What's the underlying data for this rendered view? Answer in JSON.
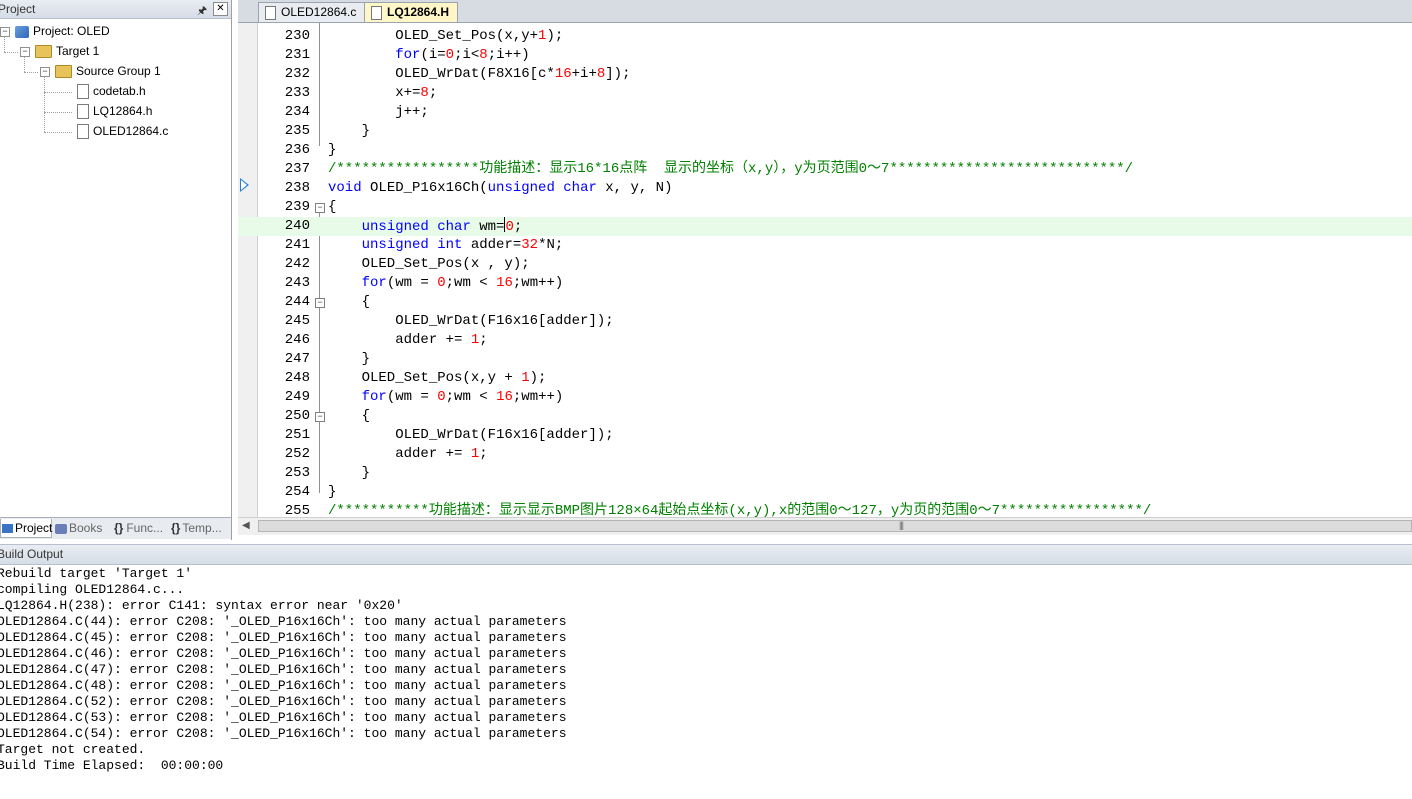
{
  "project_panel": {
    "title": "Project",
    "pin_icon": "pin-icon",
    "close_icon": "close-icon",
    "tree": [
      {
        "label": "Project: OLED",
        "icon": "project-icon"
      },
      {
        "label": "Target 1",
        "icon": "folder-icon"
      },
      {
        "label": "Source Group 1",
        "icon": "folder-icon"
      },
      {
        "label": "codetab.h",
        "icon": "file-icon"
      },
      {
        "label": "LQ12864.h",
        "icon": "file-icon"
      },
      {
        "label": "OLED12864.c",
        "icon": "file-icon"
      }
    ],
    "tabs": [
      {
        "label": "Project",
        "icon": "project-icon"
      },
      {
        "label": "Books",
        "icon": "books-icon"
      },
      {
        "label": "Func...",
        "icon": "functions-icon"
      },
      {
        "label": "Temp...",
        "icon": "templates-icon"
      }
    ]
  },
  "editor": {
    "tabs": [
      {
        "label": "OLED12864.c"
      },
      {
        "label": "LQ12864.H"
      }
    ],
    "lines": [
      {
        "num": "230",
        "code": "        OLED_Set_Pos(x,y+1);"
      },
      {
        "num": "231",
        "code": "        for(i=0;i<8;i++)"
      },
      {
        "num": "232",
        "code": "        OLED_WrDat(F8X16[c*16+i+8]);"
      },
      {
        "num": "233",
        "code": "        x+=8;"
      },
      {
        "num": "234",
        "code": "        j++;"
      },
      {
        "num": "235",
        "code": "    }"
      },
      {
        "num": "236",
        "code": "}"
      },
      {
        "num": "237",
        "code": "/*****************功能描述：显示16*16点阵  显示的坐标（x,y），y为页范围0～7****************************/"
      },
      {
        "num": "238",
        "code": "void OLED_P16x16Ch(unsigned char x, y, N)"
      },
      {
        "num": "239",
        "code": "{"
      },
      {
        "num": "240",
        "code": "    unsigned char wm=0;"
      },
      {
        "num": "241",
        "code": "    unsigned int adder=32*N;"
      },
      {
        "num": "242",
        "code": "    OLED_Set_Pos(x , y);"
      },
      {
        "num": "243",
        "code": "    for(wm = 0;wm < 16;wm++)"
      },
      {
        "num": "244",
        "code": "    {"
      },
      {
        "num": "245",
        "code": "        OLED_WrDat(F16x16[adder]);"
      },
      {
        "num": "246",
        "code": "        adder += 1;"
      },
      {
        "num": "247",
        "code": "    }"
      },
      {
        "num": "248",
        "code": "    OLED_Set_Pos(x,y + 1);"
      },
      {
        "num": "249",
        "code": "    for(wm = 0;wm < 16;wm++)"
      },
      {
        "num": "250",
        "code": "    {"
      },
      {
        "num": "251",
        "code": "        OLED_WrDat(F16x16[adder]);"
      },
      {
        "num": "252",
        "code": "        adder += 1;"
      },
      {
        "num": "253",
        "code": "    }"
      },
      {
        "num": "254",
        "code": "}"
      },
      {
        "num": "255",
        "code": "/***********功能描述：显示显示BMP图片128×64起始点坐标(x,y),x的范围0～127，y为页的范围0～7*****************/"
      }
    ]
  },
  "build_output": {
    "title": "Build Output",
    "lines": [
      "Rebuild target 'Target 1'",
      "compiling OLED12864.c...",
      "LQ12864.H(238): error C141: syntax error near '0x20'",
      "OLED12864.C(44): error C208: '_OLED_P16x16Ch': too many actual parameters",
      "OLED12864.C(45): error C208: '_OLED_P16x16Ch': too many actual parameters",
      "OLED12864.C(46): error C208: '_OLED_P16x16Ch': too many actual parameters",
      "OLED12864.C(47): error C208: '_OLED_P16x16Ch': too many actual parameters",
      "OLED12864.C(48): error C208: '_OLED_P16x16Ch': too many actual parameters",
      "OLED12864.C(52): error C208: '_OLED_P16x16Ch': too many actual parameters",
      "OLED12864.C(53): error C208: '_OLED_P16x16Ch': too many actual parameters",
      "OLED12864.C(54): error C208: '_OLED_P16x16Ch': too many actual parameters",
      "Target not created.",
      "Build Time Elapsed:  00:00:00"
    ]
  },
  "colors": {
    "keyword": "#0000ff",
    "number": "#ff0000",
    "comment": "#008000",
    "current_line": "#e8fae8",
    "active_tab": "#fff7c8"
  }
}
